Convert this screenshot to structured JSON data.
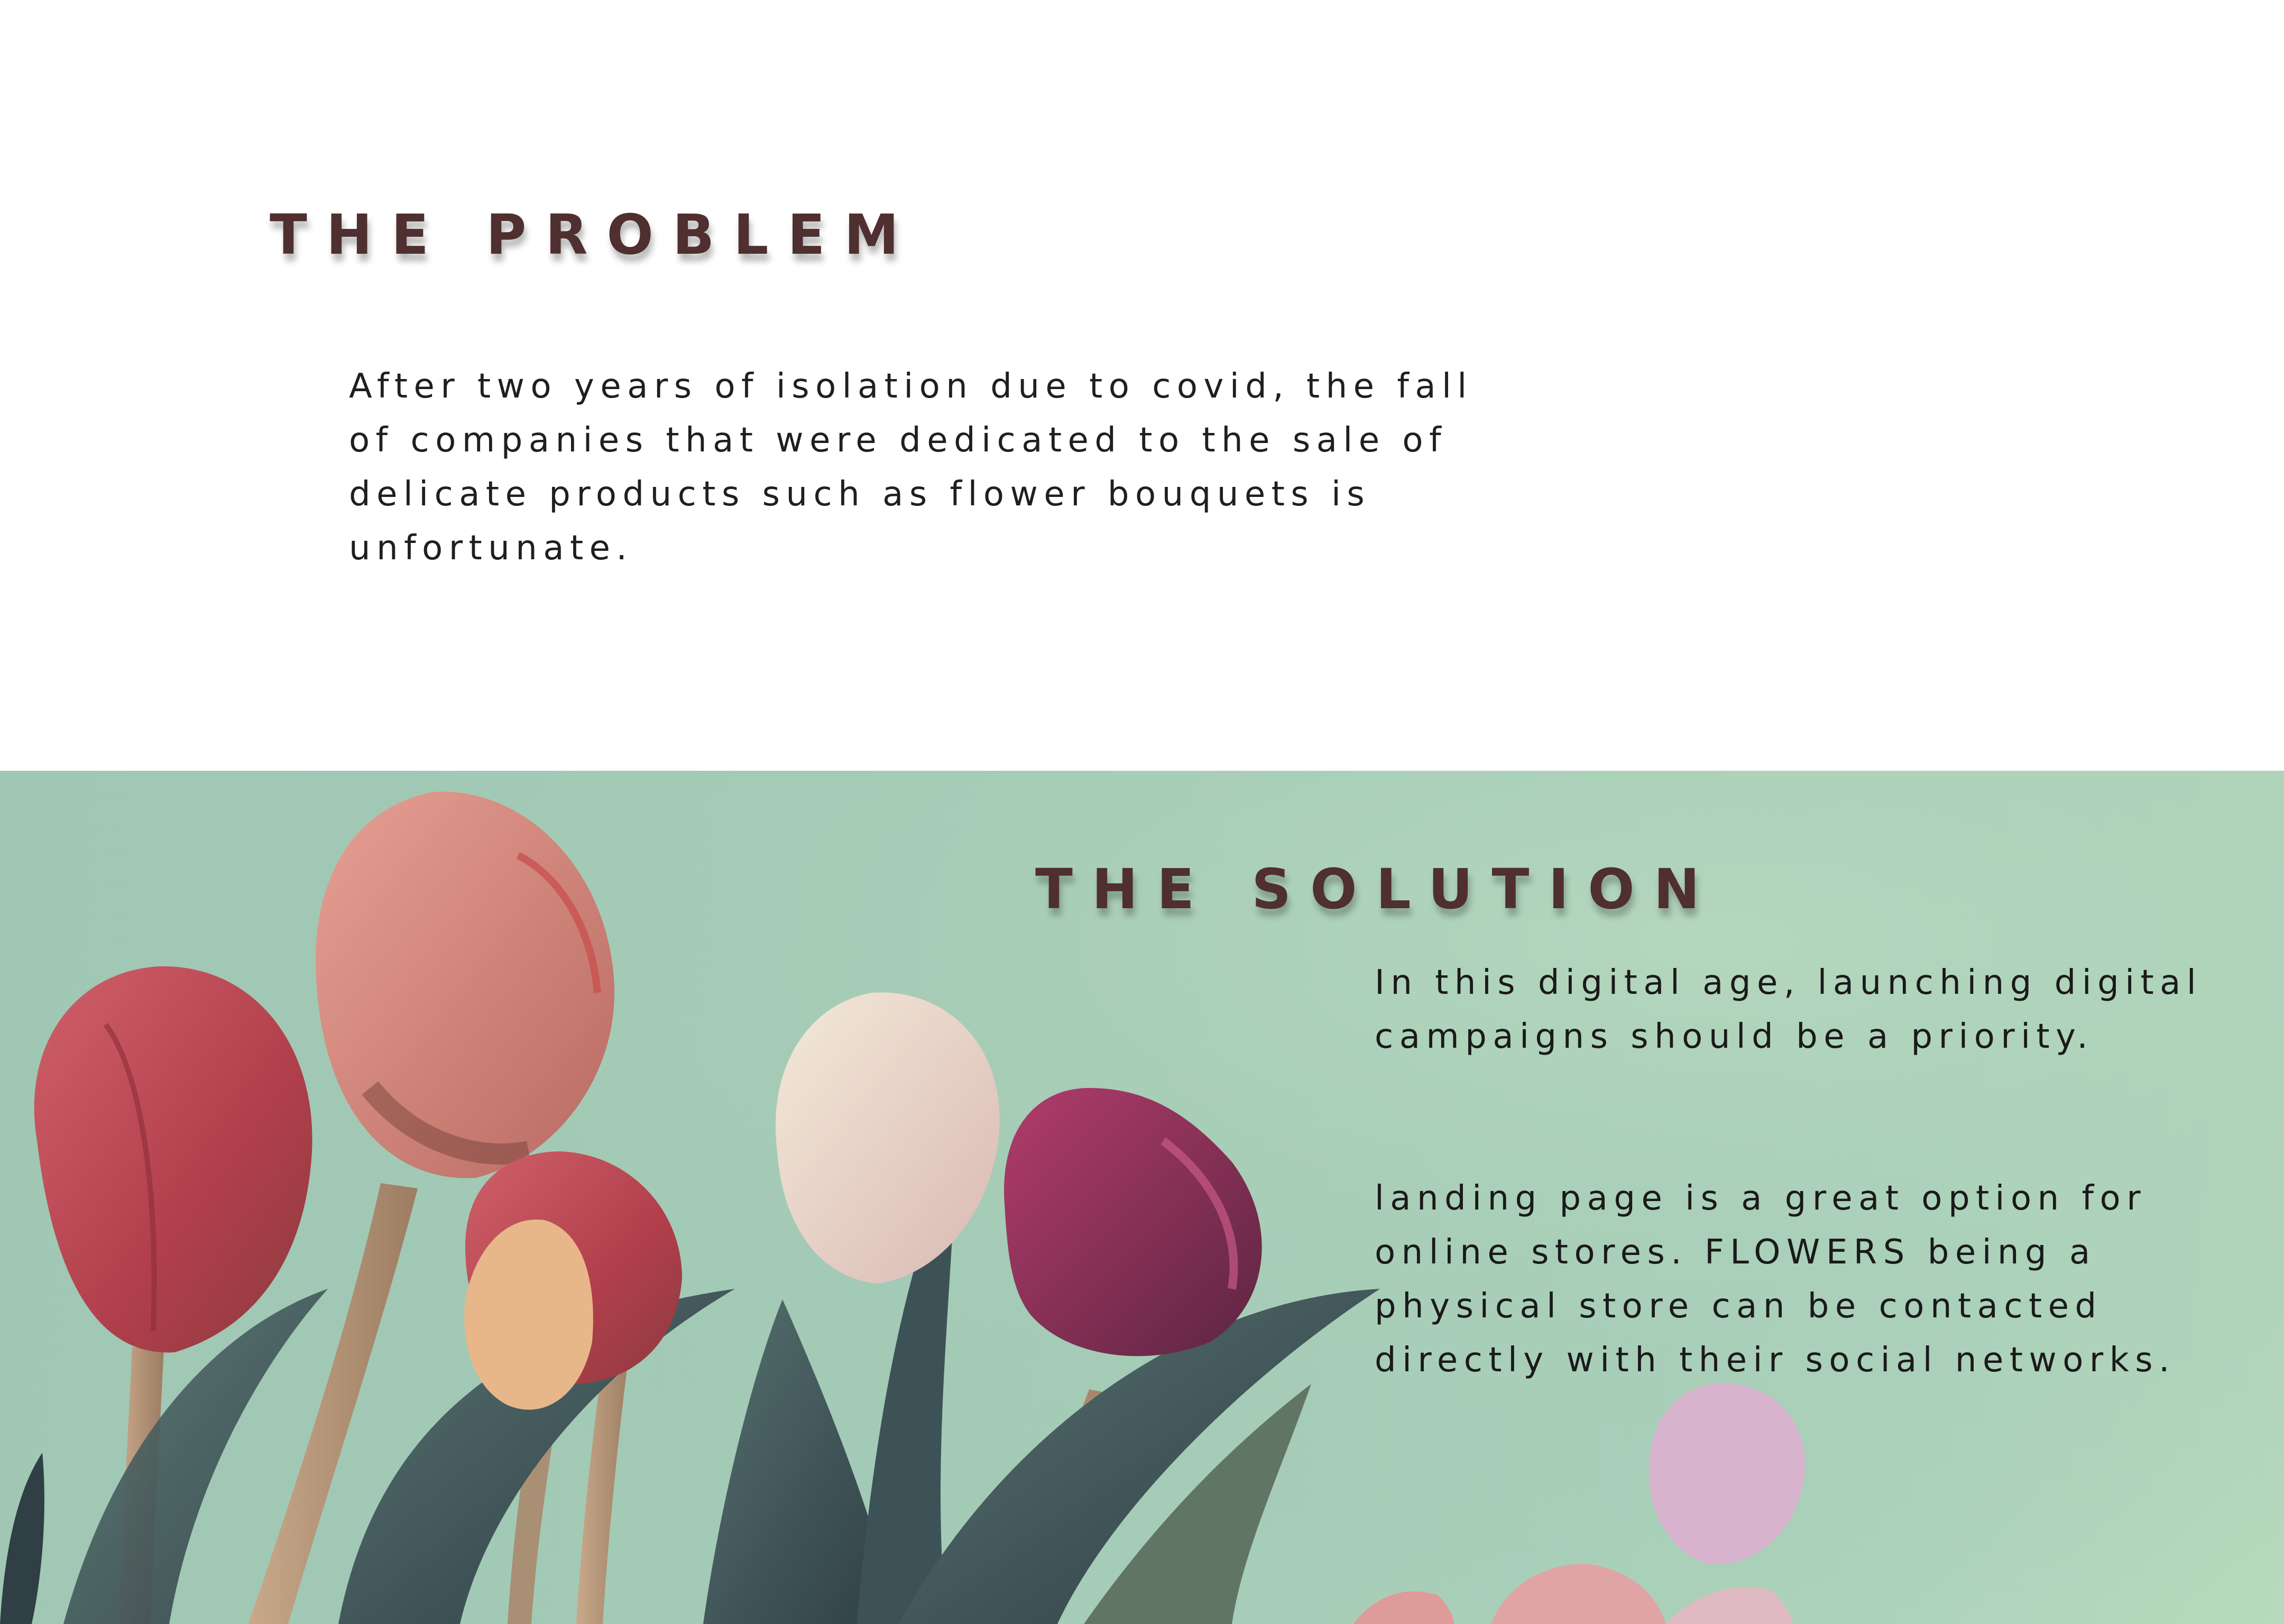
{
  "problem": {
    "title": "THE PROBLEM",
    "text": "After two years of isolation due to covid, the fall of companies that were dedicated to the sale of delicate products such as flower bouquets is unfortunate."
  },
  "solution": {
    "title": "THE SOLUTION",
    "paragraph_1": "In this digital age, launching digital campaigns should be a priority.",
    "paragraph_2": "landing page is a great option for online stores. FLOWERS being a physical store can be contacted directly with their social networks."
  },
  "colors": {
    "heading": "#4f2f2f",
    "body_text": "#1f1f1f",
    "solution_background": "#a4cbb6",
    "tulip_red": "#b8454f",
    "tulip_pink": "#d98a8a",
    "tulip_cream": "#eadcc6",
    "tulip_purple": "#7a2a4e",
    "leaf": "#4b5e63"
  },
  "icons": {
    "background_image": "tulip-bouquet-photo"
  }
}
